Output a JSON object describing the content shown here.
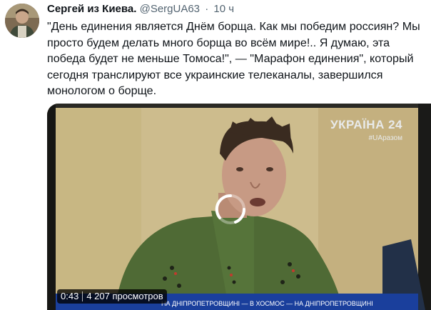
{
  "tweet": {
    "author_name": "Сергей из Киева.",
    "author_handle": "@SergUA63",
    "separator": "·",
    "timestamp": "10 ч",
    "text": "\"День единения является Днём борща. Как мы победим россиян? Мы просто будем делать много борща во всём мире!.. Я думаю, эта победа будет не меньше Томоса!\", — \"Марафон единения\", который сегодня транслируют все украинские телеканалы, завершился монологом о борще."
  },
  "video": {
    "duration": "0:43",
    "views": "4 207 просмотров",
    "channel_logo": "УКРАЇНА 24",
    "channel_hashtag": "#UAразом",
    "ticker_text": "НА ДНІПРОПЕТРОВЩИНІ — В ХОСМОС — НА ДНІПРОПЕТРОВЩИНІ"
  },
  "colors": {
    "shirt": "#4f6a35",
    "background_wall": "#d2c08f",
    "text_secondary": "#536471"
  }
}
